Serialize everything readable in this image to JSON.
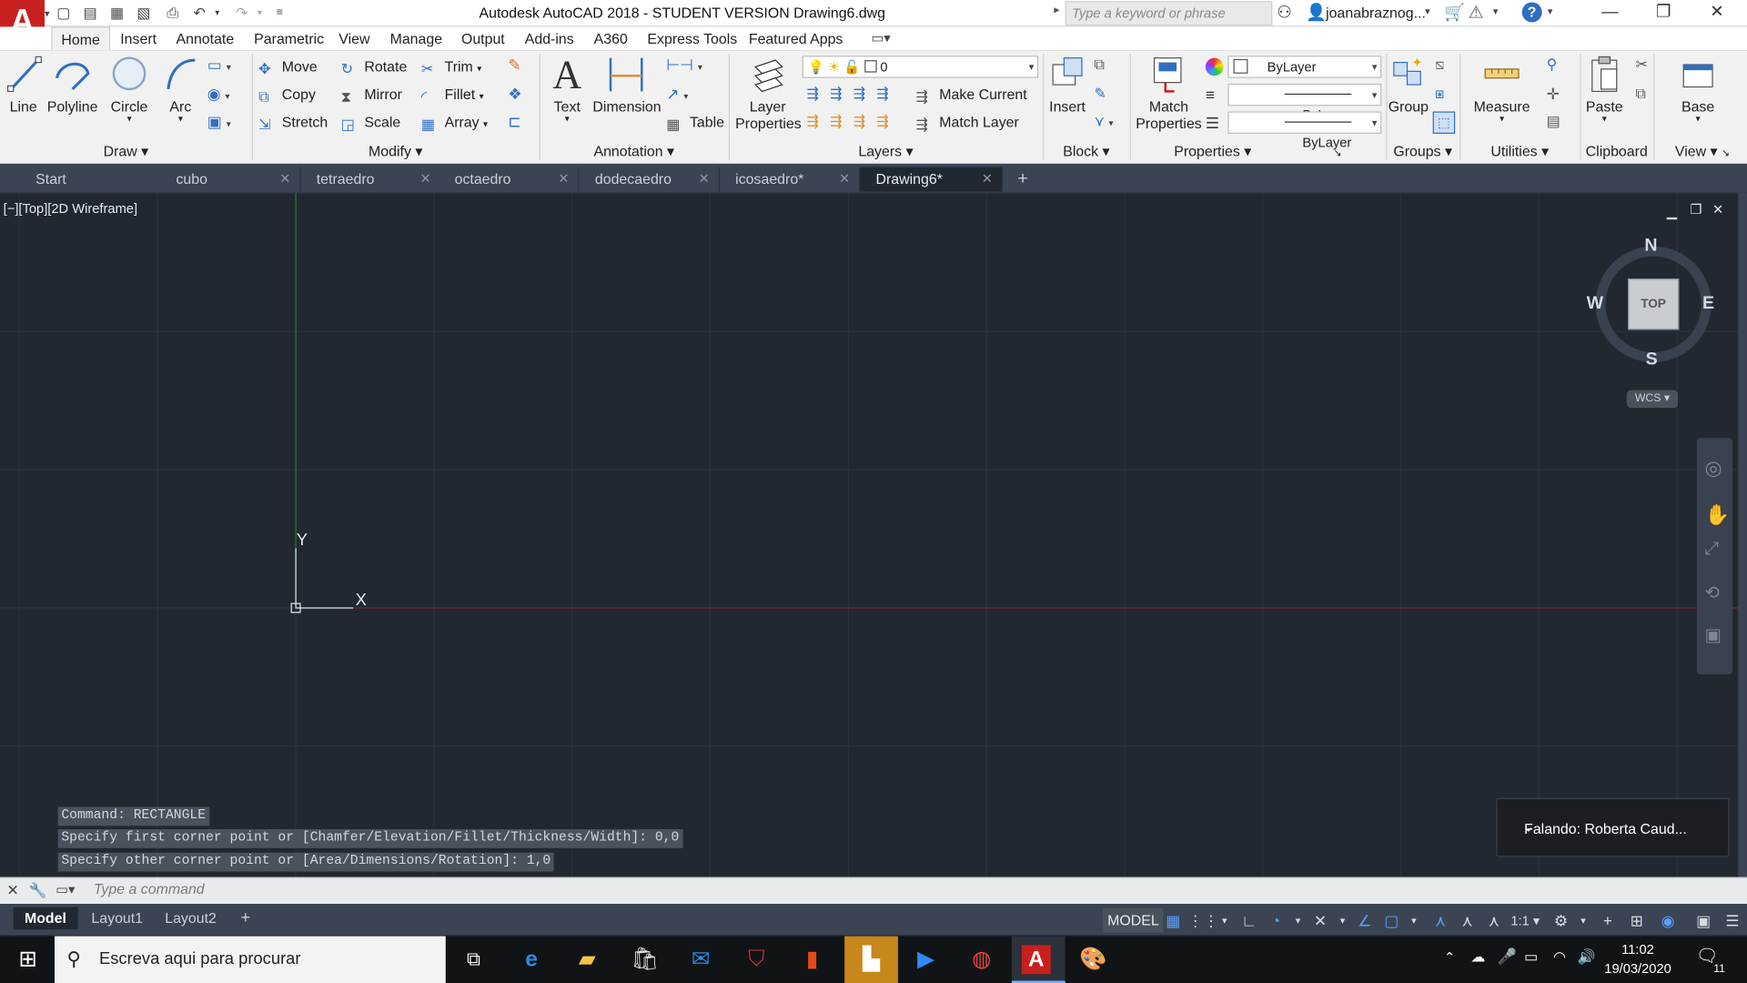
{
  "title_bar": {
    "app_title": "Autodesk AutoCAD 2018 - STUDENT VERSION    Drawing6.dwg",
    "search_placeholder": "Type a keyword or phrase",
    "user_name": "joanabraznog..."
  },
  "ribbon_tabs": [
    "Home",
    "Insert",
    "Annotate",
    "Parametric",
    "View",
    "Manage",
    "Output",
    "Add-ins",
    "A360",
    "Express Tools",
    "Featured Apps"
  ],
  "draw": {
    "line": "Line",
    "polyline": "Polyline",
    "circle": "Circle",
    "arc": "Arc",
    "panel": "Draw"
  },
  "modify": {
    "move": "Move",
    "rotate": "Rotate",
    "trim": "Trim",
    "copy": "Copy",
    "mirror": "Mirror",
    "fillet": "Fillet",
    "stretch": "Stretch",
    "scale": "Scale",
    "array": "Array",
    "panel": "Modify"
  },
  "annotation": {
    "text": "Text",
    "dimension": "Dimension",
    "table": "Table",
    "panel": "Annotation"
  },
  "layers": {
    "layer_properties": "Layer Properties",
    "current_layer": "0",
    "make_current": "Make Current",
    "match_layer": "Match Layer",
    "panel": "Layers"
  },
  "block": {
    "insert": "Insert",
    "panel": "Block"
  },
  "properties": {
    "match_properties": "Match Properties",
    "color": "ByLayer",
    "linetype": "ByLayer",
    "lineweight": "ByLayer",
    "panel": "Properties"
  },
  "groups": {
    "group": "Group",
    "panel": "Groups"
  },
  "utilities": {
    "measure": "Measure",
    "panel": "Utilities"
  },
  "clipboard": {
    "paste": "Paste",
    "panel": "Clipboard"
  },
  "view": {
    "base": "Base",
    "panel": "View"
  },
  "doc_tabs": [
    "Start",
    "cubo",
    "tetraedro",
    "octaedro",
    "dodecaedro",
    "icosaedro*",
    "Drawing6*"
  ],
  "viewport": {
    "label": "[−][Top][2D Wireframe]",
    "ucs_x": "X",
    "ucs_y": "Y",
    "viewcube": {
      "n": "N",
      "s": "S",
      "e": "E",
      "w": "W",
      "top": "TOP",
      "wcs": "WCS"
    }
  },
  "command_history": [
    "Command: RECTANGLE",
    "Specify first corner point or [Chamfer/Elevation/Fillet/Thickness/Width]: 0,0",
    "Specify other corner point or [Area/Dimensions/Rotation]: 1,0"
  ],
  "command_placeholder": "Type a command",
  "layout_tabs": [
    "Model",
    "Layout1",
    "Layout2"
  ],
  "status": {
    "model": "MODEL",
    "scale": "1:1"
  },
  "notification": "Falando: Roberta  Caud...",
  "taskbar": {
    "search_text": "Escreva aqui para procurar",
    "time": "11:02",
    "date": "19/03/2020",
    "notifications": "11"
  },
  "colors": {
    "canvas": "#212830",
    "ribbon": "#f1f1f1",
    "autocad_red": "#c8201e",
    "taskbar": "#101417"
  }
}
